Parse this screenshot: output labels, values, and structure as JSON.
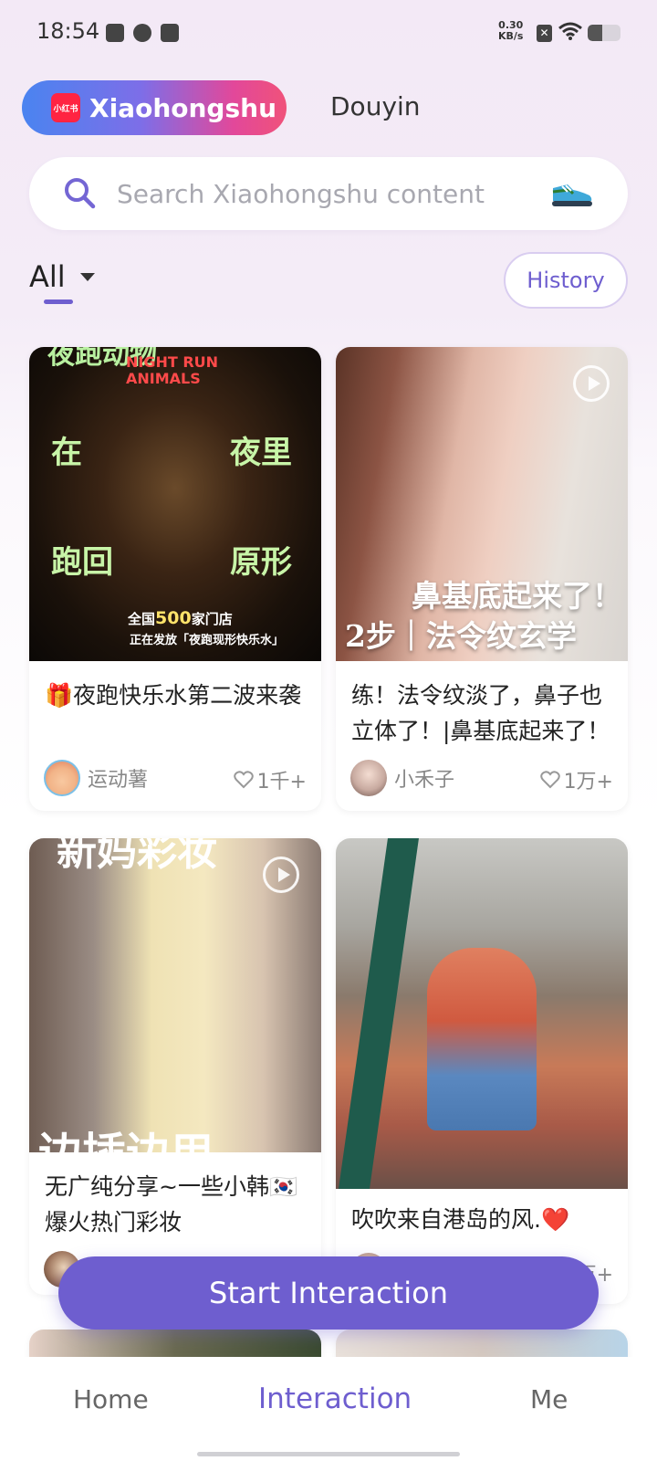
{
  "status_bar": {
    "time": "18:54",
    "net_speed_value": "0.30",
    "net_speed_unit": "KB/s",
    "battery_level": 0.45
  },
  "platform_tabs": [
    {
      "label": "Xiaohongshu",
      "logo_text": "小红书",
      "active": true
    },
    {
      "label": "Douyin",
      "active": false
    }
  ],
  "search": {
    "placeholder": "Search Xiaohongshu content",
    "value": ""
  },
  "filter": {
    "selected": "All",
    "history_label": "History"
  },
  "feed": [
    {
      "title": "🎁夜跑快乐水第二波来袭",
      "author": "运动薯",
      "likes": "1千+",
      "video": false,
      "image_text": {
        "logo_cn": "夜跑动物",
        "brand_line1": "NIGHT RUN",
        "brand_line2": "ANIMALS",
        "w1": "在",
        "w2": "夜里",
        "w3": "跑回",
        "w4": "原形",
        "bottom1_a": "全国",
        "bottom1_b": "500",
        "bottom1_c": "家门店",
        "bottom2": "正在发放「夜跑现形快乐水」"
      }
    },
    {
      "title": "练！法令纹淡了，鼻子也立体了！|鼻基底起来了！",
      "author": "小禾子",
      "likes": "1万+",
      "video": true,
      "image_text": {
        "line1": "鼻基底起来了！",
        "line2": "2步｜法令纹玄学"
      }
    },
    {
      "title": "无广纯分享~一些小韩🇰🇷爆火热门彩妆",
      "author": "",
      "likes": "",
      "video": true,
      "image_text": {
        "top": "新妈彩妆",
        "bottom": "边插边用"
      }
    },
    {
      "title": "吹吹来自港岛的风.❤️",
      "author": "",
      "likes": "万+",
      "video": false
    }
  ],
  "start_button": "Start Interaction",
  "bottom_nav": [
    {
      "label": "Home",
      "active": false
    },
    {
      "label": "Interaction",
      "active": true
    },
    {
      "label": "Me",
      "active": false
    }
  ],
  "colors": {
    "accent": "#6e5ecf",
    "xhs_red": "#ff2442"
  }
}
